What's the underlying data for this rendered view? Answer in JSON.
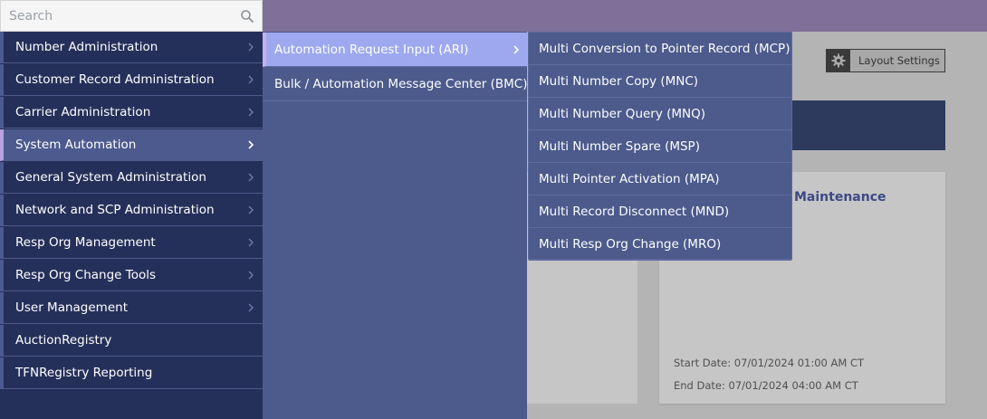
{
  "search": {
    "placeholder": "Search"
  },
  "main_menu": {
    "items": [
      {
        "label": "Number Administration",
        "has_submenu": true
      },
      {
        "label": "Customer Record Administration",
        "has_submenu": true
      },
      {
        "label": "Carrier Administration",
        "has_submenu": true
      },
      {
        "label": "System Automation",
        "has_submenu": true,
        "active": true
      },
      {
        "label": "General System Administration",
        "has_submenu": true
      },
      {
        "label": "Network and SCP Administration",
        "has_submenu": true
      },
      {
        "label": "Resp Org Management",
        "has_submenu": true
      },
      {
        "label": "Resp Org Change Tools",
        "has_submenu": true
      },
      {
        "label": "User Management",
        "has_submenu": true
      },
      {
        "label": "AuctionRegistry",
        "has_submenu": false
      },
      {
        "label": "TFNRegistry Reporting",
        "has_submenu": false
      }
    ]
  },
  "system_automation_menu": {
    "items": [
      {
        "label": "Automation Request Input (ARI)",
        "has_submenu": true,
        "active": true
      },
      {
        "label": "Bulk / Automation Message Center (BMC)",
        "has_submenu": false
      }
    ]
  },
  "ari_menu": {
    "items": [
      {
        "label": "Multi Conversion to Pointer Record (MCP)"
      },
      {
        "label": "Multi Number Copy (MNC)"
      },
      {
        "label": "Multi Number Query (MNQ)"
      },
      {
        "label": "Multi Number Spare (MSP)"
      },
      {
        "label": "Multi Pointer Activation (MPA)"
      },
      {
        "label": "Multi Record Disconnect (MND)"
      },
      {
        "label": "Multi Resp Org Change (MRO)"
      }
    ]
  },
  "background": {
    "layout_settings_label": "Layout Settings",
    "card_title": "Maintenance",
    "start_date": "Start Date: 07/01/2024 01:00 AM CT",
    "end_date": "End Date:  07/01/2024 04:00 AM CT"
  },
  "colors": {
    "menu_dark": "#25305a",
    "menu_mid": "#4c5a8c",
    "menu_highlight": "#9ea8ee",
    "topbar": "#7f7099"
  }
}
